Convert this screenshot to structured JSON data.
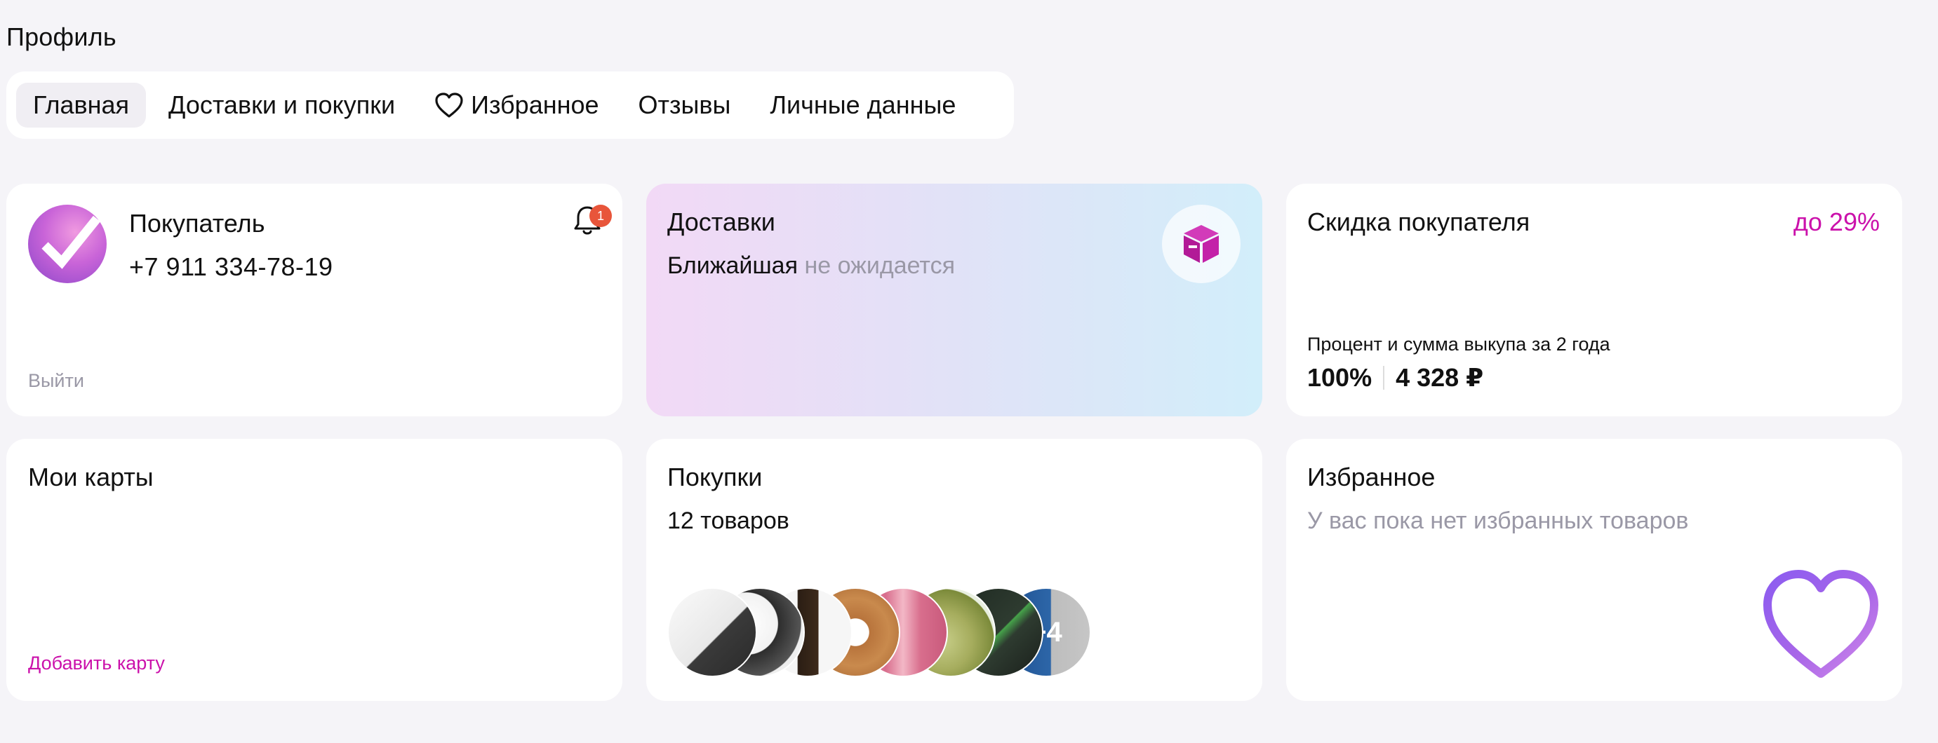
{
  "page": {
    "title": "Профиль"
  },
  "tabs": [
    {
      "label": "Главная",
      "active": true
    },
    {
      "label": "Доставки и покупки"
    },
    {
      "label": "Избранное",
      "icon": "heart-icon"
    },
    {
      "label": "Отзывы"
    },
    {
      "label": "Личные данные"
    }
  ],
  "user": {
    "name": "Покупатель",
    "phone": "+7 911 334-78-19",
    "notifications": "1",
    "logout": "Выйти"
  },
  "delivery": {
    "title": "Доставки",
    "nearest_label": "Ближайшая",
    "nearest_value": "не ожидается",
    "icon": "box-icon"
  },
  "discount": {
    "title": "Скидка покупателя",
    "value": "до 29%",
    "description": "Процент и сумма выкупа за 2 года",
    "percent": "100%",
    "amount": "4 328 ₽"
  },
  "cards": {
    "title": "Мои карты",
    "add_label": "Добавить карту"
  },
  "purchases": {
    "title": "Покупки",
    "count": "12 товаров",
    "more": "+4"
  },
  "favorites": {
    "title": "Избранное",
    "empty": "У вас пока нет избранных товаров"
  },
  "colors": {
    "accent": "#cb11ab",
    "background": "#f5f4f8",
    "muted": "#9a98a6",
    "badge": "#e8553a"
  }
}
